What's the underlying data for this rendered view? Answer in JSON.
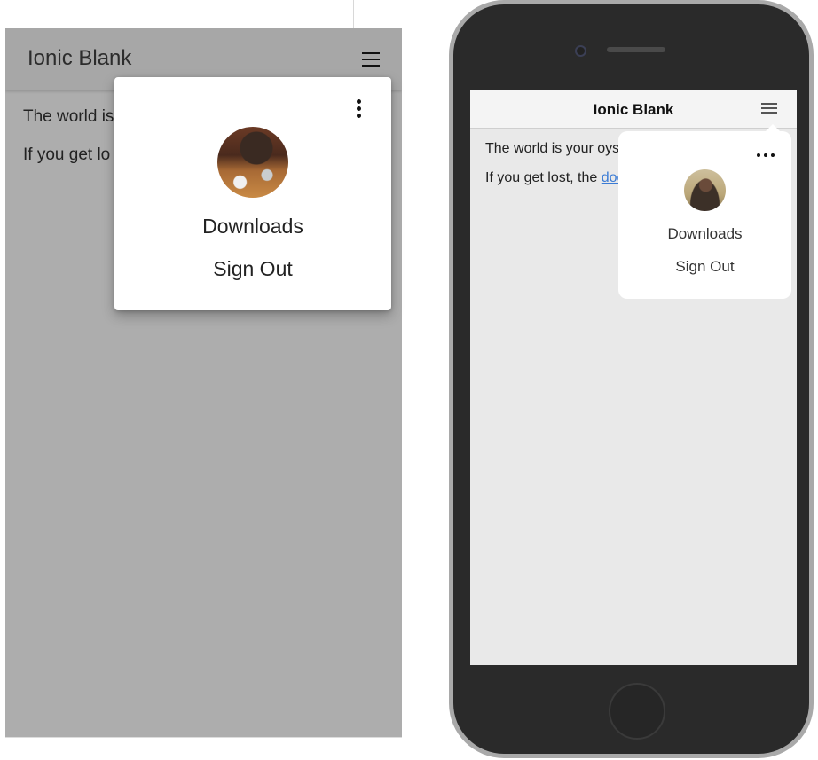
{
  "android_preview": {
    "toolbar": {
      "title": "Ionic Blank",
      "menu_icon": "hamburger-icon"
    },
    "content": {
      "line1": "The world is",
      "line2": "If you get lo"
    },
    "popover": {
      "more_icon": "vertical-dots-icon",
      "avatar": "avatar-photo",
      "items": [
        {
          "label": "Downloads"
        },
        {
          "label": "Sign Out"
        }
      ]
    },
    "colors": {
      "backdrop": "#adadad",
      "popover": "#ffffff"
    }
  },
  "ios_preview": {
    "toolbar": {
      "title": "Ionic Blank",
      "menu_icon": "hamburger-icon"
    },
    "content": {
      "line1": "The world is your oyst",
      "line2_prefix": "If you get lost, the ",
      "line2_link": "doc"
    },
    "popover": {
      "more_icon": "horizontal-dots-icon",
      "avatar": "avatar-photo",
      "items": [
        {
          "label": "Downloads"
        },
        {
          "label": "Sign Out"
        }
      ]
    },
    "colors": {
      "screen": "#e9e9e9",
      "link": "#3a7bd5",
      "phone_body": "#2a2a2a"
    }
  }
}
